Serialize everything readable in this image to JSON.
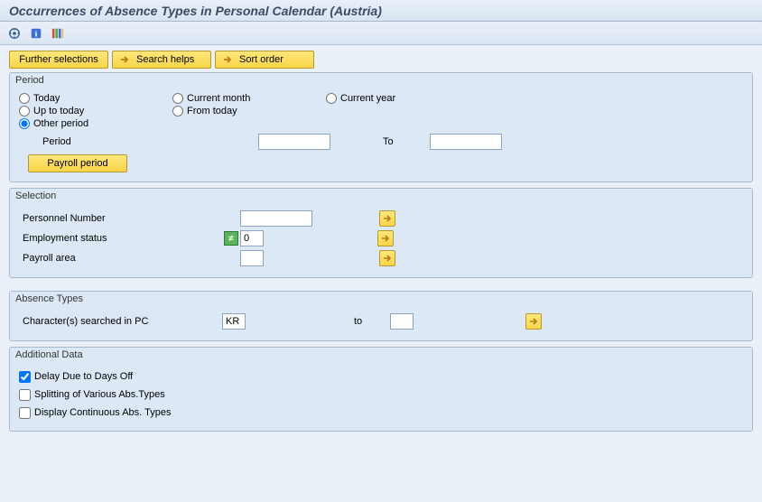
{
  "header": {
    "title": "Occurrences of Absence Types in Personal Calendar (Austria)"
  },
  "toolbar": {
    "execute_icon": "execute-icon",
    "info_icon": "info-icon",
    "colors_icon": "colors-icon"
  },
  "actions": {
    "further_selections": "Further selections",
    "search_helps": "Search helps",
    "sort_order": "Sort order"
  },
  "period": {
    "group_title": "Period",
    "today": "Today",
    "current_month": "Current month",
    "current_year": "Current year",
    "up_to_today": "Up to today",
    "from_today": "From today",
    "other_period": "Other period",
    "period_label": "Period",
    "period_from": "",
    "to_label": "To",
    "period_to": "",
    "payroll_period": "Payroll period"
  },
  "selection": {
    "group_title": "Selection",
    "pernr_label": "Personnel Number",
    "pernr_value": "",
    "empstat_label": "Employment status",
    "empstat_value": "0",
    "payarea_label": "Payroll area",
    "payarea_value": ""
  },
  "absence": {
    "group_title": "Absence Types",
    "char_label": "Character(s) searched in PC",
    "char_from": "KR",
    "to_label": "to",
    "char_to": ""
  },
  "additional": {
    "group_title": "Additional Data",
    "delay": "Delay Due to Days Off",
    "splitting": "Splitting of Various Abs.Types",
    "display_cont": "Display Continuous Abs. Types"
  }
}
